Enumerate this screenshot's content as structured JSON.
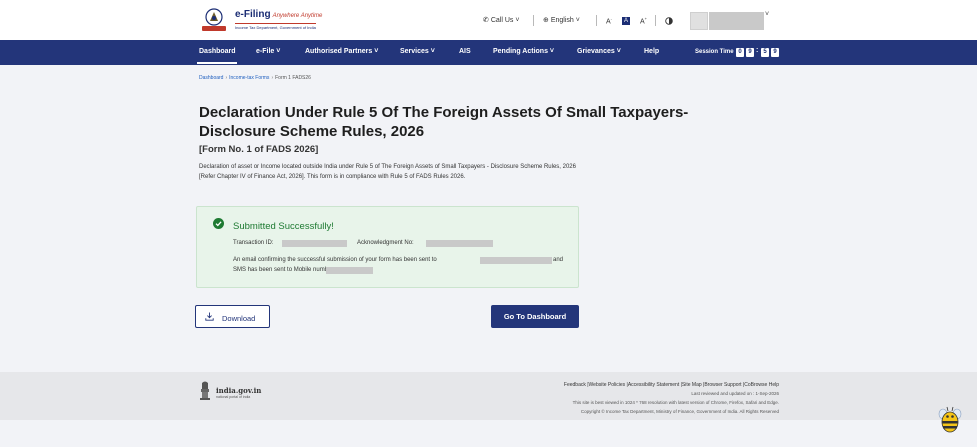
{
  "header": {
    "logo_title": "e-Filing",
    "logo_tagline": "Anywhere Anytime",
    "logo_sub": "Income Tax Department, Government of India",
    "call_us": "Call Us",
    "language": "English",
    "font_decrease": "A",
    "font_normal": "A",
    "font_increase": "A",
    "user_chevron": "˅"
  },
  "nav": {
    "items": [
      "Dashboard",
      "e-File",
      "Authorised Partners",
      "Services",
      "AIS",
      "Pending Actions",
      "Grievances",
      "Help"
    ],
    "session_label": "Session Time",
    "session_digits": [
      "0",
      "9",
      "5",
      "9"
    ],
    "session_colon": ":"
  },
  "breadcrumb": {
    "items": [
      "Dashboard",
      "Income-tax Forms",
      "Form 1 FADS26"
    ],
    "separator": "›"
  },
  "main": {
    "title": "Declaration Under Rule 5 Of The Foreign Assets Of Small Taxpayers- Disclosure Scheme Rules, 2026",
    "form_no": "[Form No. 1 of FADS 2026]",
    "description": "Declaration of asset or Income located outside India under Rule 5 of The Foreign Assets of Small Taxpayers - Disclosure Scheme Rules, 2026 [Refer Chapter IV of Finance Act, 2026]. This form is in compliance with Rule 5 of FADS Rules 2026."
  },
  "success": {
    "title": "Submitted Successfully!",
    "transaction_label": "Transaction ID:",
    "ack_label": "Acknowledgment No:",
    "email_text": "An email confirming the successful submission of your form has been sent to",
    "email_and": "and",
    "sms_text": "SMS has been sent to Mobile number:"
  },
  "buttons": {
    "download": "Download",
    "dashboard": "Go To Dashboard"
  },
  "footer": {
    "india_gov": "india.gov.in",
    "india_gov_sub": "national portal of india",
    "links": "Feedback |Website Policies |Accessibility Statement |Site Map |Browser Support |CoBrowse Help",
    "last_reviewed": "Last reviewed and updated on : 1-Sep-2026",
    "best_viewed": "This site is best viewed in 1024 * 768 resolution with latest version of Chrome, Firefox, Safari and Edge.",
    "copyright": "Copyright © Income Tax Department, Ministry of Finance, Government of India. All Rights Reserved"
  },
  "colors": {
    "brand_navy": "#23357a",
    "success_green": "#1e7a32",
    "success_bg": "#e8f4ea",
    "link_blue": "#1f5fbf"
  },
  "icons": [
    "phone-icon",
    "globe-icon",
    "chevron-down-icon",
    "contrast-icon",
    "check-circle-icon",
    "download-icon",
    "emblem-icon",
    "chatbot-bee-icon"
  ]
}
